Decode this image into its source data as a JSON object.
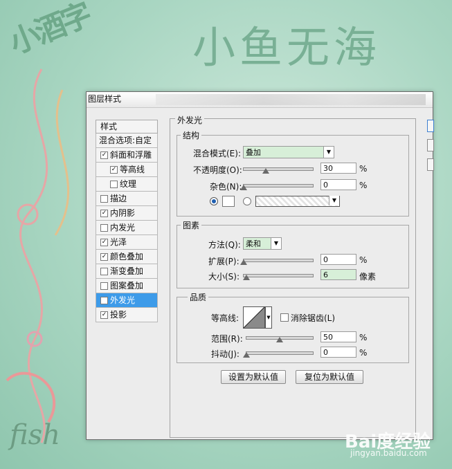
{
  "background": {
    "logo_left": "小酒字",
    "logo_right": "小鱼无海",
    "signature": "fish",
    "watermark": "Bai度经验",
    "watermark_url": "jingyan.baidu.com"
  },
  "dialog": {
    "title": "图层样式",
    "left_panel": {
      "header": "样式",
      "blend_options": "混合选项:自定",
      "items": [
        {
          "label": "斜面和浮雕",
          "checked": true,
          "indent": false,
          "selected": false
        },
        {
          "label": "等高线",
          "checked": true,
          "indent": true,
          "selected": false
        },
        {
          "label": "纹理",
          "checked": false,
          "indent": true,
          "selected": false
        },
        {
          "label": "描边",
          "checked": false,
          "indent": false,
          "selected": false
        },
        {
          "label": "内阴影",
          "checked": true,
          "indent": false,
          "selected": false
        },
        {
          "label": "内发光",
          "checked": false,
          "indent": false,
          "selected": false
        },
        {
          "label": "光泽",
          "checked": true,
          "indent": false,
          "selected": false
        },
        {
          "label": "颜色叠加",
          "checked": true,
          "indent": false,
          "selected": false
        },
        {
          "label": "渐变叠加",
          "checked": false,
          "indent": false,
          "selected": false
        },
        {
          "label": "图案叠加",
          "checked": false,
          "indent": false,
          "selected": false
        },
        {
          "label": "外发光",
          "checked": true,
          "indent": false,
          "selected": true
        },
        {
          "label": "投影",
          "checked": true,
          "indent": false,
          "selected": false
        }
      ]
    },
    "outer_glow": {
      "section_title": "外发光",
      "structure": {
        "title": "结构",
        "blend_mode_label": "混合模式(E):",
        "blend_mode_value": "叠加",
        "opacity_label": "不透明度(O):",
        "opacity_value": "30",
        "opacity_level": 0.3,
        "noise_label": "杂色(N):",
        "noise_value": "0",
        "noise_level": 0,
        "percent": "%"
      },
      "elements": {
        "title": "图素",
        "technique_label": "方法(Q):",
        "technique_value": "柔和",
        "spread_label": "扩展(P):",
        "spread_value": "0",
        "spread_level": 0,
        "size_label": "大小(S):",
        "size_value": "6",
        "size_level": 0.03,
        "percent": "%",
        "px_unit": "像素"
      },
      "quality": {
        "title": "品质",
        "contour_label": "等高线:",
        "antialias_label": "消除锯齿(L)",
        "antialias_checked": false,
        "range_label": "范围(R):",
        "range_value": "50",
        "range_level": 0.5,
        "jitter_label": "抖动(J):",
        "jitter_value": "0",
        "jitter_level": 0,
        "percent": "%"
      },
      "buttons": {
        "set_default": "设置为默认值",
        "reset_default": "复位为默认值"
      }
    }
  }
}
